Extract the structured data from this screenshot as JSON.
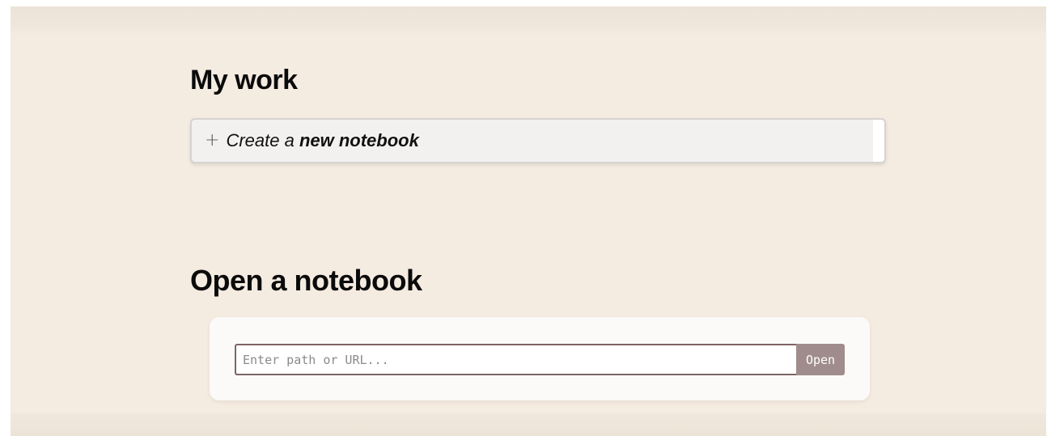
{
  "my_work": {
    "heading": "My work",
    "new_notebook": {
      "plus": "+",
      "prefix": "Create a ",
      "bold": "new notebook"
    }
  },
  "open_notebook": {
    "heading": "Open a notebook",
    "input": {
      "placeholder": "Enter path or URL...",
      "value": ""
    },
    "button_label": "Open"
  },
  "colors": {
    "background": "#f4ebe1",
    "open_button": "#a08c8c",
    "input_border": "#7e6466"
  }
}
